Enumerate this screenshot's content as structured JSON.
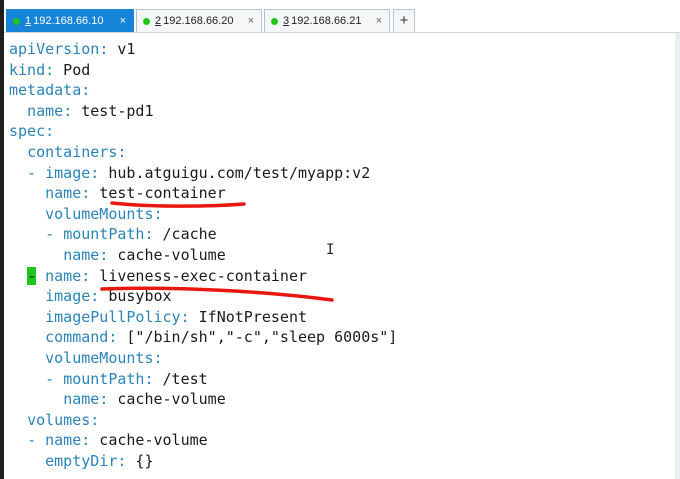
{
  "tabs": [
    {
      "number": "1",
      "label": " 192.168.66.10",
      "close": "×",
      "active": true,
      "dot_color": "#1fc41f"
    },
    {
      "number": "2",
      "label": " 192.168.66.20",
      "close": "×",
      "active": false,
      "dot_color": "#1fc41f"
    },
    {
      "number": "3",
      "label": " 192.168.66.21",
      "close": "×",
      "active": false,
      "dot_color": "#1fc41f"
    }
  ],
  "add_tab_label": "+",
  "colors": {
    "key": "#2a84b8",
    "text": "#1a1a1a",
    "cursor": "#1fc41f",
    "underline": "#e8170f",
    "active_tab": "#1684d8"
  },
  "editor": {
    "lines": [
      {
        "indent": "",
        "dash": "",
        "key": "apiVersion",
        "sep": ":",
        "value": " v1"
      },
      {
        "indent": "",
        "dash": "",
        "key": "kind",
        "sep": ":",
        "value": " Pod"
      },
      {
        "indent": "",
        "dash": "",
        "key": "metadata",
        "sep": ":",
        "value": ""
      },
      {
        "indent": "  ",
        "dash": "",
        "key": "name",
        "sep": ":",
        "value": " test-pd1"
      },
      {
        "indent": "",
        "dash": "",
        "key": "spec",
        "sep": ":",
        "value": ""
      },
      {
        "indent": "  ",
        "dash": "",
        "key": "containers",
        "sep": ":",
        "value": ""
      },
      {
        "indent": "  ",
        "dash": "- ",
        "key": "image",
        "sep": ":",
        "value": " hub.atguigu.com/test/myapp:v2"
      },
      {
        "indent": "    ",
        "dash": "",
        "key": "name",
        "sep": ":",
        "value": " test-container"
      },
      {
        "indent": "    ",
        "dash": "",
        "key": "volumeMounts",
        "sep": ":",
        "value": ""
      },
      {
        "indent": "    ",
        "dash": "- ",
        "key": "mountPath",
        "sep": ":",
        "value": " /cache"
      },
      {
        "indent": "      ",
        "dash": "",
        "key": "name",
        "sep": ":",
        "value": " cache-volume"
      },
      {
        "indent": "  ",
        "dash": "- ",
        "key": "name",
        "sep": ":",
        "value": " liveness-exec-container",
        "cursor": true
      },
      {
        "indent": "    ",
        "dash": "",
        "key": "image",
        "sep": ":",
        "value": " busybox"
      },
      {
        "indent": "    ",
        "dash": "",
        "key": "imagePullPolicy",
        "sep": ":",
        "value": " IfNotPresent"
      },
      {
        "indent": "    ",
        "dash": "",
        "key": "command",
        "sep": ":",
        "value": " [\"/bin/sh\",\"-c\",\"sleep 6000s\"]"
      },
      {
        "indent": "    ",
        "dash": "",
        "key": "volumeMounts",
        "sep": ":",
        "value": ""
      },
      {
        "indent": "    ",
        "dash": "- ",
        "key": "mountPath",
        "sep": ":",
        "value": " /test"
      },
      {
        "indent": "      ",
        "dash": "",
        "key": "name",
        "sep": ":",
        "value": " cache-volume"
      },
      {
        "indent": "  ",
        "dash": "",
        "key": "volumes",
        "sep": ":",
        "value": ""
      },
      {
        "indent": "  ",
        "dash": "- ",
        "key": "name",
        "sep": ":",
        "value": " cache-volume"
      },
      {
        "indent": "    ",
        "dash": "",
        "key": "emptyDir",
        "sep": ":",
        "value": " {}"
      }
    ],
    "mouse_cursor": "I"
  }
}
